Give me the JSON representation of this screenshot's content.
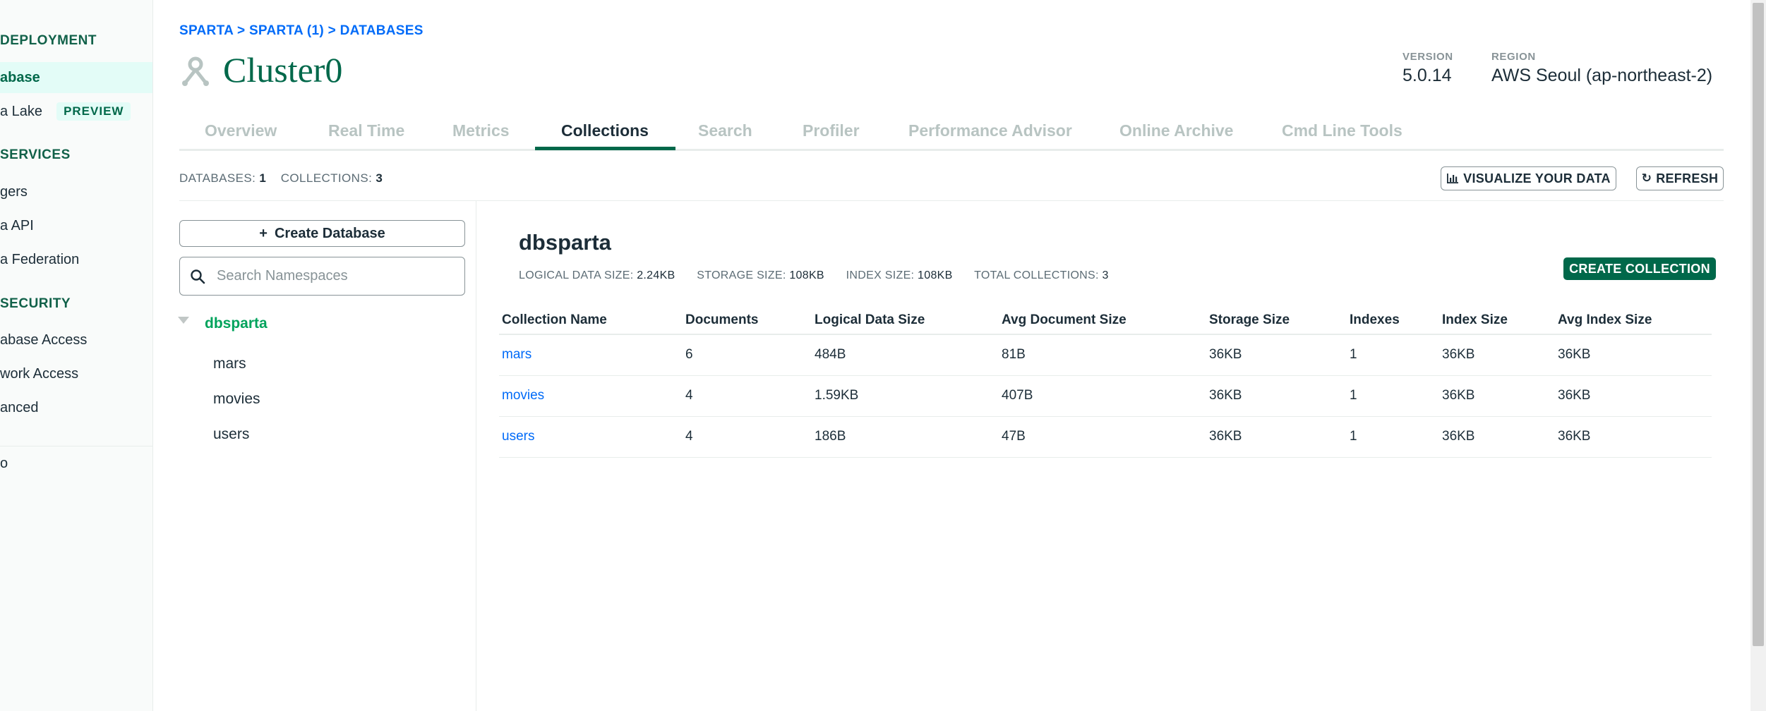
{
  "sidebar": {
    "sections": [
      {
        "label": "DEPLOYMENT"
      },
      {
        "label": "SERVICES"
      },
      {
        "label": "SECURITY"
      }
    ],
    "items": [
      {
        "label": "abase"
      },
      {
        "label": "a Lake",
        "badge": "PREVIEW"
      },
      {
        "label": "gers"
      },
      {
        "label": "a API"
      },
      {
        "label": "a Federation"
      },
      {
        "label": "abase Access"
      },
      {
        "label": "work Access"
      },
      {
        "label": "anced"
      },
      {
        "label": "o"
      }
    ]
  },
  "header": {
    "breadcrumb": "SPARTA > SPARTA (1) > DATABASES",
    "cluster_name": "Cluster0",
    "version_label": "VERSION",
    "version_value": "5.0.14",
    "region_label": "REGION",
    "region_value": "AWS Seoul (ap-northeast-2)"
  },
  "tabs": [
    {
      "label": "Overview"
    },
    {
      "label": "Real Time"
    },
    {
      "label": "Metrics"
    },
    {
      "label": "Collections",
      "active": true
    },
    {
      "label": "Search"
    },
    {
      "label": "Profiler"
    },
    {
      "label": "Performance Advisor"
    },
    {
      "label": "Online Archive"
    },
    {
      "label": "Cmd Line Tools"
    }
  ],
  "summary": {
    "databases_label": "DATABASES:",
    "databases_value": "1",
    "collections_label": "COLLECTIONS:",
    "collections_value": "3"
  },
  "actions": {
    "visualize_label": "VISUALIZE YOUR DATA",
    "refresh_label": "REFRESH"
  },
  "left_panel": {
    "create_db_label": "Create Database",
    "search_placeholder": "Search Namespaces",
    "database": "dbsparta",
    "collections": [
      "mars",
      "movies",
      "users"
    ]
  },
  "detail": {
    "db_title": "dbsparta",
    "stats": [
      {
        "label": "LOGICAL DATA SIZE:",
        "value": "2.24KB"
      },
      {
        "label": "STORAGE SIZE:",
        "value": "108KB"
      },
      {
        "label": "INDEX SIZE:",
        "value": "108KB"
      },
      {
        "label": "TOTAL COLLECTIONS:",
        "value": "3"
      }
    ],
    "create_collection_label": "CREATE COLLECTION",
    "table": {
      "headers": [
        "Collection Name",
        "Documents",
        "Logical Data Size",
        "Avg Document Size",
        "Storage Size",
        "Indexes",
        "Index Size",
        "Avg Index Size"
      ],
      "rows": [
        [
          "mars",
          "6",
          "484B",
          "81B",
          "36KB",
          "1",
          "36KB",
          "36KB"
        ],
        [
          "movies",
          "4",
          "1.59KB",
          "407B",
          "36KB",
          "1",
          "36KB",
          "36KB"
        ],
        [
          "users",
          "4",
          "186B",
          "47B",
          "36KB",
          "1",
          "36KB",
          "36KB"
        ]
      ]
    }
  },
  "colors": {
    "brand_green": "#00684a",
    "link_blue": "#016bf8",
    "active_db_green": "#00a35c"
  }
}
